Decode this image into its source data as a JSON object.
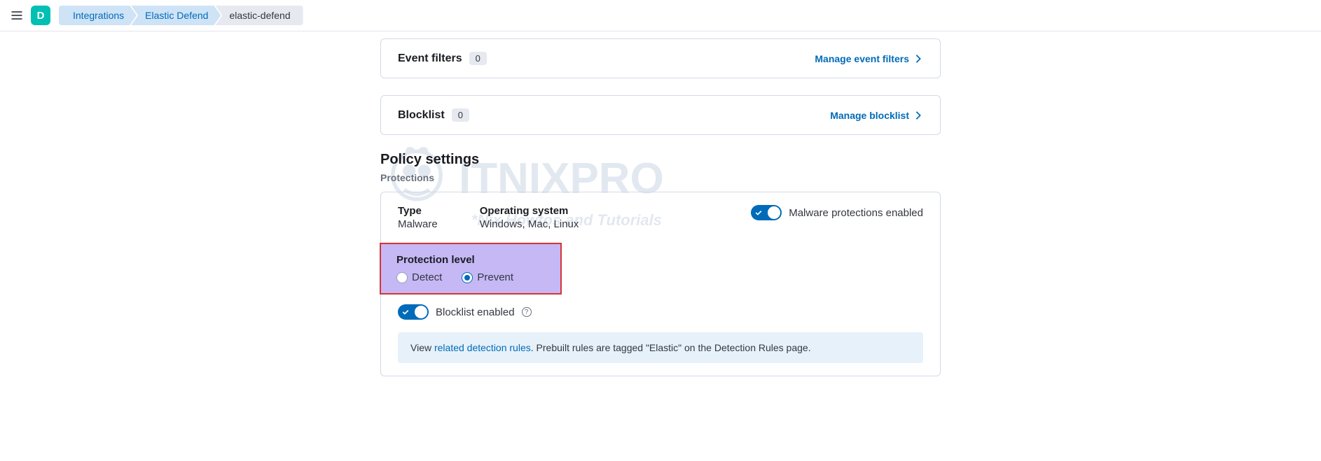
{
  "header": {
    "space_letter": "D",
    "breadcrumbs": [
      "Integrations",
      "Elastic Defend",
      "elastic-defend"
    ]
  },
  "panels": {
    "event_filters": {
      "title": "Event filters",
      "count": "0",
      "manage": "Manage event filters"
    },
    "blocklist": {
      "title": "Blocklist",
      "count": "0",
      "manage": "Manage blocklist"
    }
  },
  "policy": {
    "heading": "Policy settings",
    "subheading": "Protections",
    "type_label": "Type",
    "type_value": "Malware",
    "os_label": "Operating system",
    "os_value": "Windows, Mac, Linux",
    "malware_toggle": "Malware protections enabled",
    "protection_level_label": "Protection level",
    "detect_label": "Detect",
    "prevent_label": "Prevent",
    "blocklist_toggle": "Blocklist enabled",
    "callout_prefix": "View ",
    "callout_link": "related detection rules",
    "callout_suffix": ". Prebuilt rules are tagged \"Elastic\" on the Detection Rules page."
  },
  "watermark": {
    "main": "ITNIXPRO",
    "sub": "*Nix Howtos and Tutorials"
  }
}
